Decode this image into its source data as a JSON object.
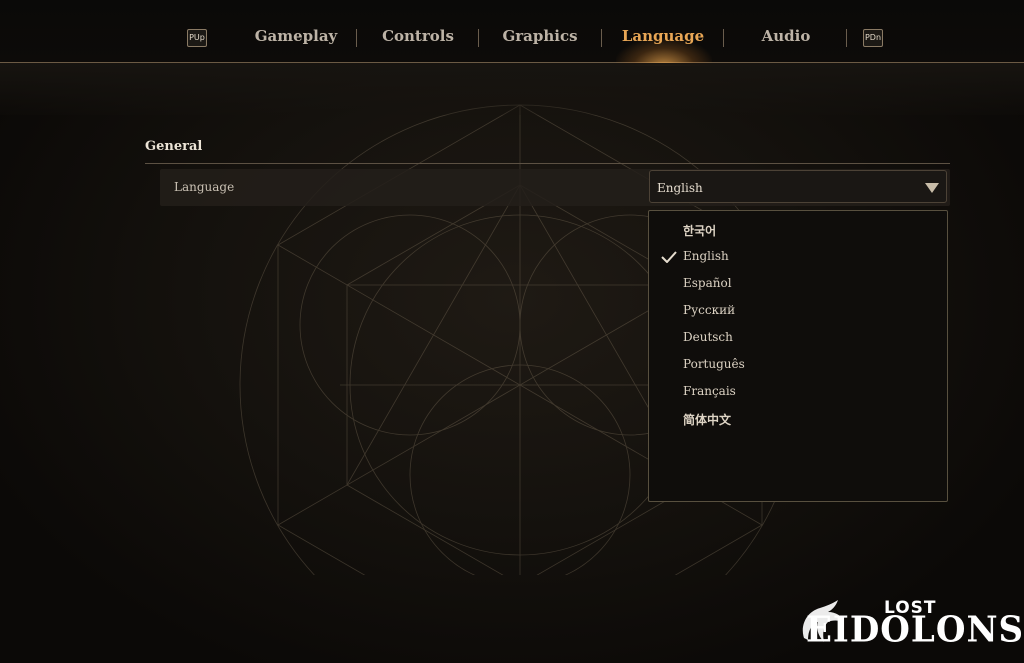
{
  "header": {
    "prev_key": "PUp",
    "next_key": "PDn",
    "tabs": [
      {
        "label": "Gameplay",
        "active": false
      },
      {
        "label": "Controls",
        "active": false
      },
      {
        "label": "Graphics",
        "active": false
      },
      {
        "label": "Language",
        "active": true
      },
      {
        "label": "Audio",
        "active": false
      }
    ]
  },
  "section": {
    "title": "General",
    "setting_label": "Language",
    "selected_value": "English"
  },
  "dropdown": {
    "options": [
      {
        "label": "한국어",
        "selected": false
      },
      {
        "label": "English",
        "selected": true
      },
      {
        "label": "Español",
        "selected": false
      },
      {
        "label": "Русский",
        "selected": false
      },
      {
        "label": "Deutsch",
        "selected": false
      },
      {
        "label": "Português",
        "selected": false
      },
      {
        "label": "Français",
        "selected": false
      },
      {
        "label": "简体中文",
        "selected": false
      }
    ]
  },
  "logo": {
    "top": "LOST",
    "main": "EIDOLONS"
  },
  "colors": {
    "accent": "#e8a655",
    "tab_text": "#bdb3a6",
    "background": "#0c0a08",
    "panel": "#231f1a"
  },
  "icons": {
    "dropdown": "triangle-down-icon",
    "selected": "checkmark-icon",
    "logo": "dragon-emblem-icon"
  }
}
